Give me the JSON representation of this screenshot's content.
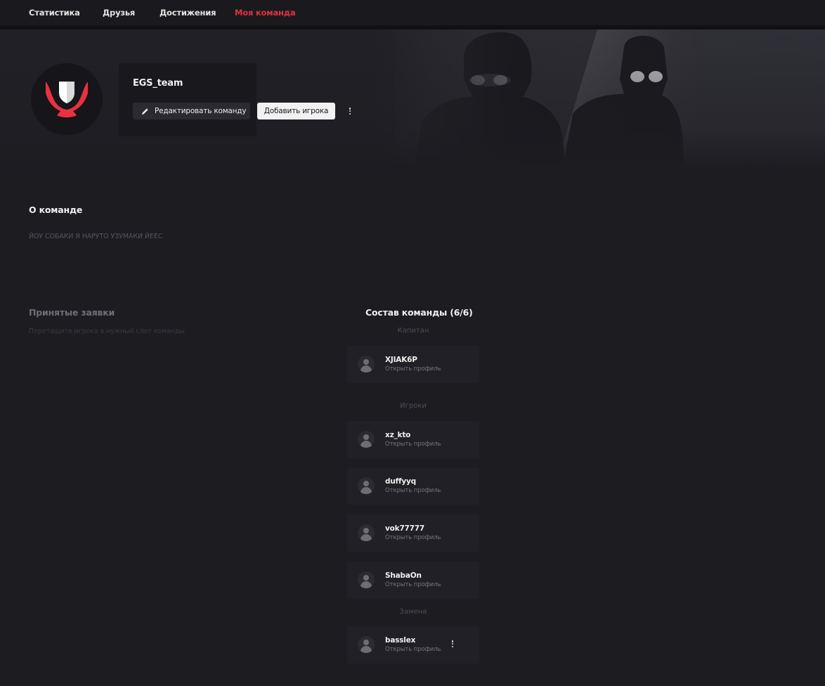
{
  "nav": {
    "items": [
      {
        "label": "Статистика"
      },
      {
        "label": "Друзья"
      },
      {
        "label": "Достижения"
      },
      {
        "label": "Моя команда"
      }
    ],
    "active_color": "#e0323f"
  },
  "team": {
    "name": "EGS_team",
    "edit_button": "Редактировать команду",
    "add_player_button": "Добавить игрока",
    "logo_icon": "shield-logo-icon",
    "brand_color": "#e8323f"
  },
  "about": {
    "title": "О команде",
    "text": "ЙОУ СОБАКИ Я НАРУТО УЗУМАКИ ЙЕЕС"
  },
  "accepted": {
    "title": "Принятые заявки",
    "hint": "Перетащите игрока в нужный слот команды"
  },
  "roster": {
    "title": "Состав команды (6/6)",
    "captain_label": "Капитан",
    "players_label": "Игроки",
    "substitute_label": "Замена",
    "captain": {
      "name": "XJIAK6P",
      "link": "Открыть профиль"
    },
    "players": [
      {
        "name": "xz_kto",
        "link": "Открыть профиль"
      },
      {
        "name": "duffyyq",
        "link": "Открыть профиль"
      },
      {
        "name": "vok77777",
        "link": "Открыть профиль"
      },
      {
        "name": "ShabaOn",
        "link": "Открыть профиль"
      }
    ],
    "substitute": {
      "name": "basslex",
      "link": "Открыть профиль"
    }
  }
}
